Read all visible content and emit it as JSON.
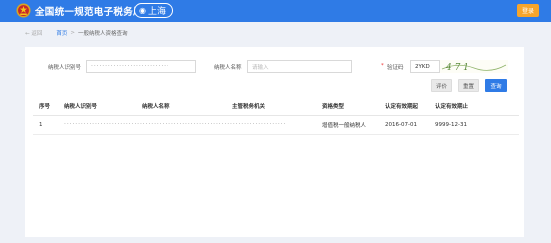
{
  "header": {
    "site_title": "全国统一规范电子税务局",
    "region": "上海",
    "login_label": "登录"
  },
  "breadcrumb": {
    "back": "返回",
    "home": "首页",
    "separator": ">",
    "current": "一般纳税人资格查询"
  },
  "form": {
    "taxpayer_id": {
      "label": "纳税人识别号",
      "value": "· · · · · · · · · · · · · · · · · · · · · · · · · · · ·"
    },
    "taxpayer_name": {
      "label": "纳税人名称",
      "placeholder": "请输入"
    },
    "captcha": {
      "required_mark": "*",
      "label": "验证码",
      "value": "2YKD",
      "image_text": "4 7 1"
    }
  },
  "buttons": {
    "evaluate": "评价",
    "reset": "重置",
    "query": "查询"
  },
  "table": {
    "headers": [
      "序号",
      "纳税人识别号",
      "纳税人名称",
      "主管税务机关",
      "资格类型",
      "认定有效期起",
      "认定有效期止"
    ],
    "rows": [
      [
        "1",
        "· · · · · · · · · · · · · · · · · · · · · · · · · · · · · · · · · · · · · · · · · · · · · · · · · · · · · · · · · · · · · · · · · · · · · · · · · · · · · · ·",
        "",
        "",
        "增值税一般纳税人",
        "2016-07-01",
        "9999-12-31"
      ]
    ]
  },
  "colors": {
    "header_bg": "#2f7be6",
    "login_bg": "#f7a52b",
    "primary": "#2f7be6",
    "page_bg": "#eef1f7"
  }
}
